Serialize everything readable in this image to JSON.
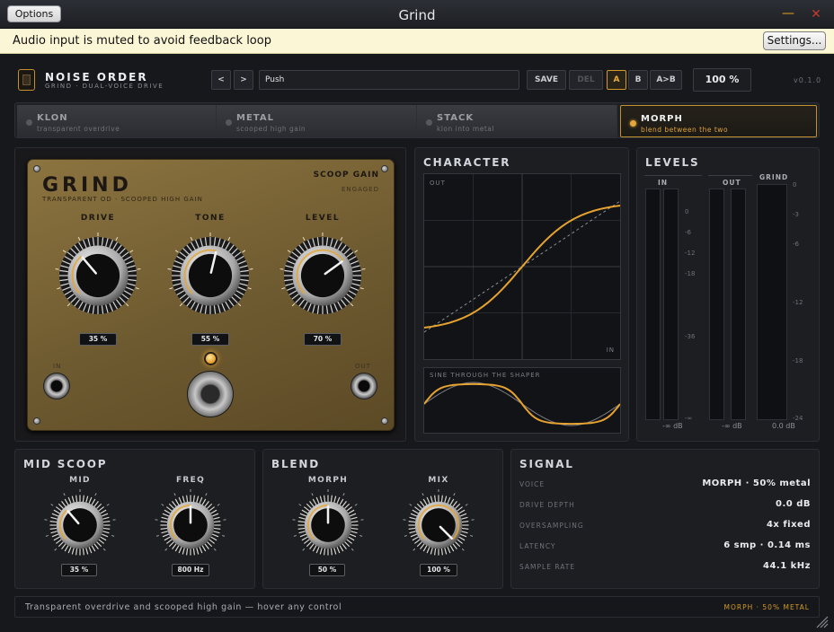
{
  "window": {
    "title": "Grind",
    "options_label": "Options",
    "minimize_glyph": "—",
    "close_glyph": "✕"
  },
  "notice": {
    "text": "Audio input is muted to avoid feedback loop",
    "settings_label": "Settings..."
  },
  "header": {
    "brand": "NOISE ORDER",
    "brand_sub": "GRIND · DUAL-VOICE DRIVE",
    "prev_label": "<",
    "next_label": ">",
    "preset_name": "Push",
    "save_label": "SAVE",
    "del_label": "DEL",
    "a_label": "A",
    "b_label": "B",
    "ab_label": "A>B",
    "zoom": "100 %",
    "version": "v0.1.0"
  },
  "voices": [
    {
      "name": "KLON",
      "sub": "transparent overdrive",
      "selected": false
    },
    {
      "name": "METAL",
      "sub": "scooped high gain",
      "selected": false
    },
    {
      "name": "STACK",
      "sub": "klon into metal",
      "selected": false
    },
    {
      "name": "MORPH",
      "sub": "blend between the two",
      "selected": true
    }
  ],
  "pedal": {
    "title": "GRIND",
    "subtitle": "TRANSPARENT OD · SCOOPED HIGH GAIN",
    "scoop_label": "SCOOP GAIN",
    "scoop_state": "ENGAGED",
    "in_label": "IN",
    "out_label": "OUT",
    "knobs": [
      {
        "label": "DRIVE",
        "value_text": "35 %",
        "value": 0.35
      },
      {
        "label": "TONE",
        "value_text": "55 %",
        "value": 0.55
      },
      {
        "label": "LEVEL",
        "value_text": "70 %",
        "value": 0.7
      }
    ],
    "accent": "#e6a330"
  },
  "character": {
    "title": "CHARACTER",
    "out_label": "OUT",
    "in_label": "IN",
    "sine_label": "SINE THROUGH THE SHAPER",
    "curve_color": "#e6a330"
  },
  "levels": {
    "title": "LEVELS",
    "meters": [
      {
        "label": "IN",
        "reading": "-∞ dB"
      },
      {
        "label": "OUT",
        "reading": "-∞ dB"
      },
      {
        "label": "GRIND",
        "reading": "0.0 dB"
      }
    ],
    "scale_io": [
      "0",
      "-6",
      "-12",
      "-18",
      "-36",
      "-∞"
    ],
    "scale_grind": [
      "0",
      "-3",
      "-6",
      "-12",
      "-18",
      "-24"
    ]
  },
  "mid_scoop": {
    "title": "MID SCOOP",
    "knobs": [
      {
        "label": "MID",
        "value_text": "35 %",
        "value": 0.35
      },
      {
        "label": "FREQ",
        "value_text": "800 Hz",
        "value": 0.5
      }
    ]
  },
  "blend": {
    "title": "BLEND",
    "knobs": [
      {
        "label": "MORPH",
        "value_text": "50 %",
        "value": 0.5
      },
      {
        "label": "MIX",
        "value_text": "100 %",
        "value": 1.0
      }
    ]
  },
  "signal": {
    "title": "SIGNAL",
    "rows": [
      {
        "key": "VOICE",
        "value": "MORPH · 50% metal"
      },
      {
        "key": "DRIVE DEPTH",
        "value": "0.0 dB"
      },
      {
        "key": "OVERSAMPLING",
        "value": "4x fixed"
      },
      {
        "key": "LATENCY",
        "value": "6 smp · 0.14 ms"
      },
      {
        "key": "SAMPLE RATE",
        "value": "44.1 kHz"
      }
    ]
  },
  "status": {
    "hint": "Transparent overdrive and scooped high gain — hover any control",
    "voice_state": "MORPH · 50% METAL"
  }
}
